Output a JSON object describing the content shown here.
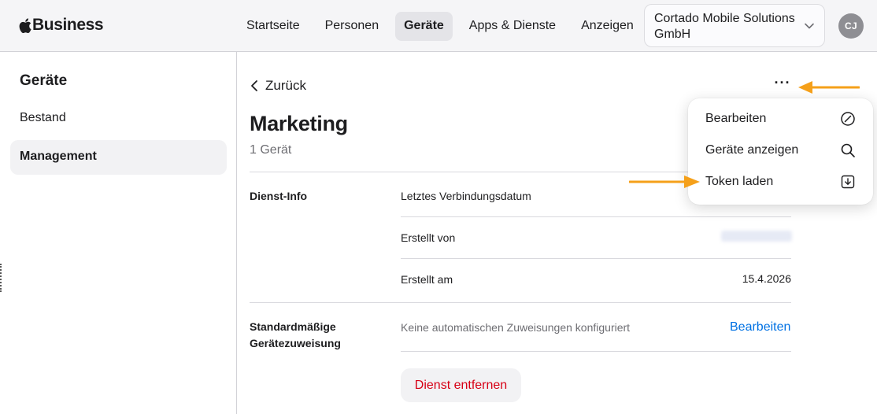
{
  "header": {
    "brand": "Business",
    "nav": [
      {
        "label": "Startseite",
        "active": false
      },
      {
        "label": "Personen",
        "active": false
      },
      {
        "label": "Geräte",
        "active": true
      },
      {
        "label": "Apps & Dienste",
        "active": false
      },
      {
        "label": "Anzeigen",
        "active": false
      }
    ],
    "org_line1": "Cortado Mobile Solutions",
    "org_line2": "GmbH",
    "avatar_initials": "CJ"
  },
  "sidebar": {
    "title": "Geräte",
    "items": [
      {
        "label": "Bestand",
        "active": false
      },
      {
        "label": "Management",
        "active": true
      }
    ]
  },
  "main": {
    "back_label": "Zurück",
    "title": "Marketing",
    "subtitle": "1 Gerät",
    "more_label": "···",
    "service_info": {
      "section_label": "Dienst-Info",
      "rows": [
        {
          "label": "Letztes Verbindungsdatum",
          "value": ""
        },
        {
          "label": "Erstellt von",
          "value": ""
        },
        {
          "label": "Erstellt am",
          "value": "15.4.2026"
        }
      ]
    },
    "default_assignment": {
      "label_line1": "Standardmäßige",
      "label_line2": "Gerätezuweisung",
      "value": "Keine automatischen Zuweisungen konfiguriert",
      "edit_link": "Bearbeiten"
    },
    "remove_button": "Dienst entfernen"
  },
  "menu": {
    "items": [
      {
        "label": "Bearbeiten",
        "icon": "slash-circle-icon"
      },
      {
        "label": "Geräte anzeigen",
        "icon": "search-icon"
      },
      {
        "label": "Token laden",
        "icon": "download-icon"
      }
    ]
  },
  "colors": {
    "accent": "#0071e3",
    "destructive": "#d70015",
    "annotation_arrow": "#f5a01a"
  }
}
